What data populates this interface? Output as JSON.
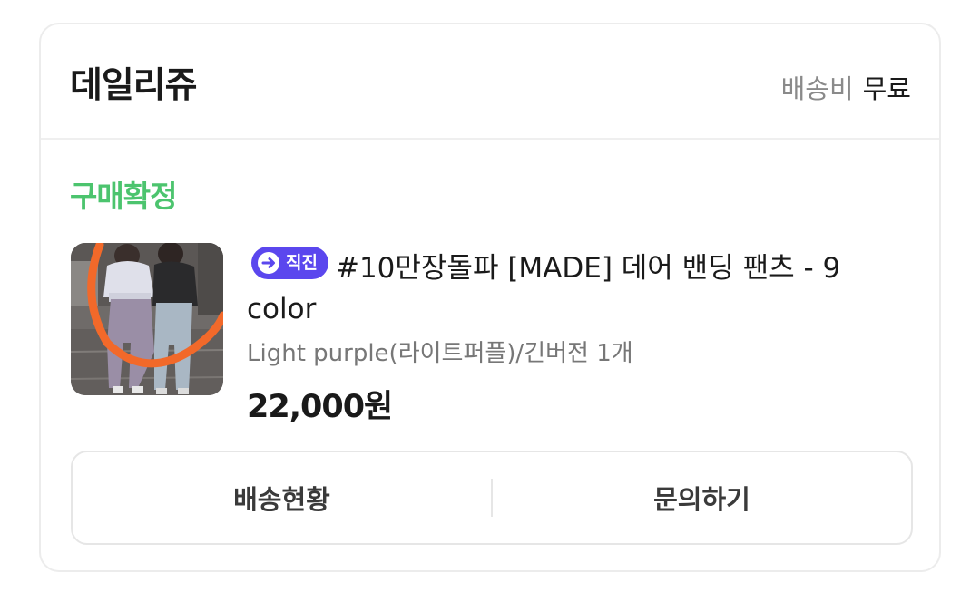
{
  "store": {
    "name": "데일리쥬",
    "shipping_label": "배송비",
    "shipping_value": "무료"
  },
  "order": {
    "status": "구매확정",
    "status_color": "#4cc46e"
  },
  "product": {
    "badge": "직진",
    "badge_color": "#5b47ee",
    "badge_icon": "arrow-right-circle-icon",
    "title": "#10만장돌파 [MADE] 데어 밴딩 팬츠 - 9 color",
    "option": "Light purple(라이트퍼플)/긴버전 1개",
    "price": "22,000원"
  },
  "actions": {
    "delivery_status": "배송현황",
    "inquiry": "문의하기"
  }
}
